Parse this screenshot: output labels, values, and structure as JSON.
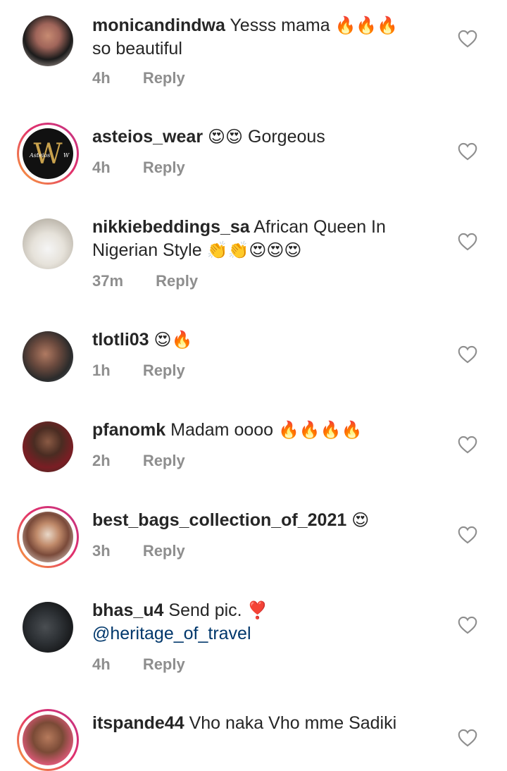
{
  "comments": [
    {
      "username": "monicandindwa",
      "text": "Yesss mama",
      "emojis": "🔥🔥🔥",
      "text2": "so beautiful",
      "time": "4h",
      "reply": "Reply"
    },
    {
      "username": "asteios_wear",
      "emojis": "😍😍",
      "text": "Gorgeous",
      "time": "4h",
      "reply": "Reply"
    },
    {
      "username": "nikkiebeddings_sa",
      "text": "African Queen In Nigerian Style",
      "emojis": "👏👏😍😍😍",
      "time": "37m",
      "reply": "Reply"
    },
    {
      "username": "tlotli03",
      "emojis": "😍🔥",
      "time": "1h",
      "reply": "Reply"
    },
    {
      "username": "pfanomk",
      "text": "Madam oooo",
      "emojis": "🔥🔥🔥🔥",
      "time": "2h",
      "reply": "Reply"
    },
    {
      "username": "best_bags_collection_of_2021",
      "emojis": "😍",
      "time": "3h",
      "reply": "Reply"
    },
    {
      "username": "bhas_u4",
      "text": "Send pic.",
      "emojis": "❣️",
      "mention": "@heritage_of_travel",
      "time": "4h",
      "reply": "Reply"
    },
    {
      "username": "itspande44",
      "text": "Vho naka Vho mme Sadiki"
    }
  ],
  "avatars": {
    "asteios_logo_text": "Asteios",
    "asteios_logo_mark": "W",
    "asteios_logo_suffix": "W"
  },
  "icons": {
    "like": "heart-outline-icon"
  },
  "colors": {
    "story_ring_start": "#f9a53a",
    "story_ring_end": "#c13584",
    "meta_gray": "#8e8e8e",
    "mention": "#00376b"
  }
}
